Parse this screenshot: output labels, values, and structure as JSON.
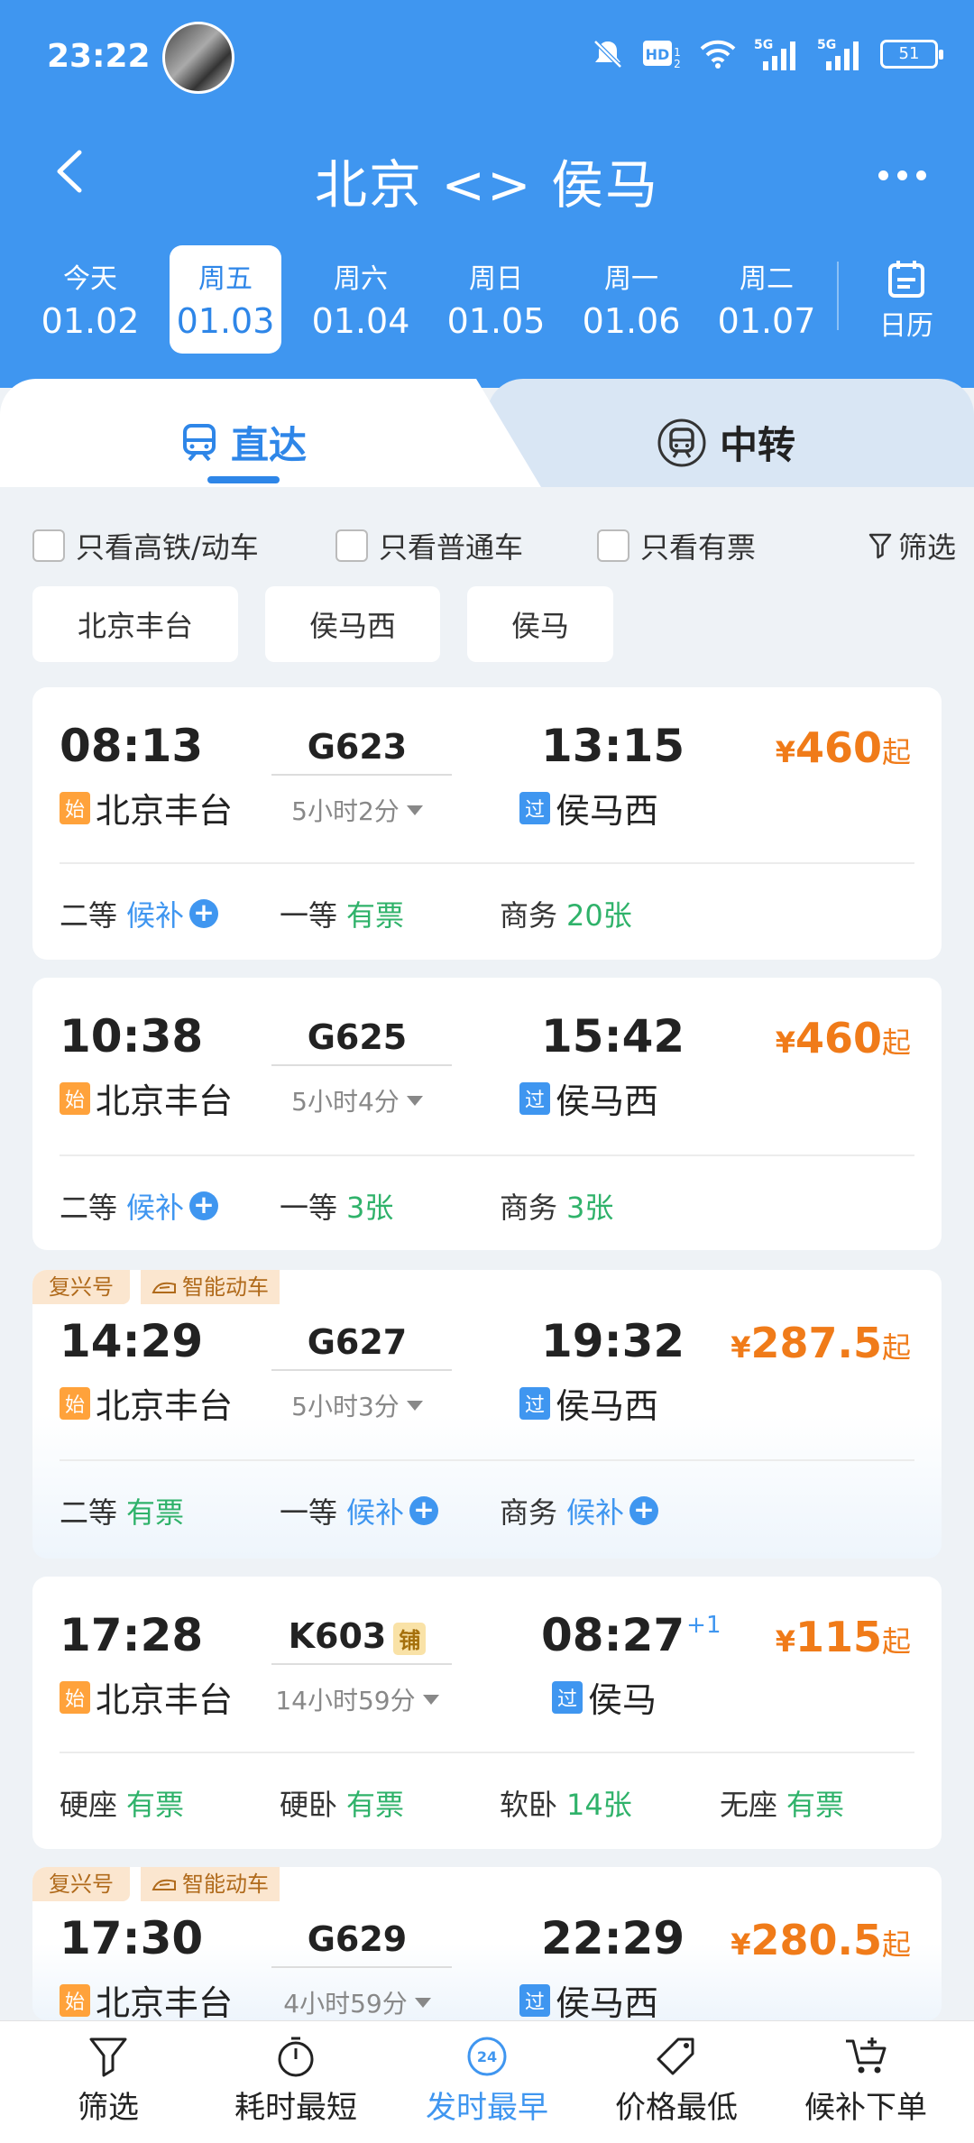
{
  "status": {
    "time": "23:22",
    "battery": "51"
  },
  "nav": {
    "title": "北京 <> 侯马"
  },
  "dates": [
    {
      "weekday": "今天",
      "date": "01.02",
      "active": false
    },
    {
      "weekday": "周五",
      "date": "01.03",
      "active": true
    },
    {
      "weekday": "周六",
      "date": "01.04",
      "active": false
    },
    {
      "weekday": "周日",
      "date": "01.05",
      "active": false
    },
    {
      "weekday": "周一",
      "date": "01.06",
      "active": false
    },
    {
      "weekday": "周二",
      "date": "01.07",
      "active": false
    }
  ],
  "calendar_label": "日历",
  "tabs": {
    "direct": "直达",
    "transfer": "中转"
  },
  "filters": {
    "high_speed": "只看高铁/动车",
    "normal": "只看普通车",
    "available": "只看有票",
    "filter": "筛选"
  },
  "stations": [
    "北京丰台",
    "侯马西",
    "侯马"
  ],
  "trains": [
    {
      "dep_time": "08:13",
      "train_no": "G623",
      "arr_time": "13:15",
      "arr_plus": "",
      "dep_tag": "始",
      "dep_station": "北京丰台",
      "duration": "5小时2分",
      "arr_tag": "过",
      "arr_station": "侯马西",
      "price_yen": "¥",
      "price": "460",
      "price_suffix": "起",
      "badges": [],
      "berth": "",
      "seats": [
        {
          "name": "二等",
          "status": "候补",
          "type": "wait"
        },
        {
          "name": "一等",
          "status": "有票",
          "type": "avail"
        },
        {
          "name": "商务",
          "status": "20张",
          "type": "avail"
        }
      ]
    },
    {
      "dep_time": "10:38",
      "train_no": "G625",
      "arr_time": "15:42",
      "arr_plus": "",
      "dep_tag": "始",
      "dep_station": "北京丰台",
      "duration": "5小时4分",
      "arr_tag": "过",
      "arr_station": "侯马西",
      "price_yen": "¥",
      "price": "460",
      "price_suffix": "起",
      "badges": [],
      "berth": "",
      "seats": [
        {
          "name": "二等",
          "status": "候补",
          "type": "wait"
        },
        {
          "name": "一等",
          "status": "3张",
          "type": "avail"
        },
        {
          "name": "商务",
          "status": "3张",
          "type": "avail"
        }
      ]
    },
    {
      "dep_time": "14:29",
      "train_no": "G627",
      "arr_time": "19:32",
      "arr_plus": "",
      "dep_tag": "始",
      "dep_station": "北京丰台",
      "duration": "5小时3分",
      "arr_tag": "过",
      "arr_station": "侯马西",
      "price_yen": "¥",
      "price": "287.5",
      "price_suffix": "起",
      "badges": [
        "复兴号",
        "智能动车"
      ],
      "berth": "",
      "seats": [
        {
          "name": "二等",
          "status": "有票",
          "type": "avail"
        },
        {
          "name": "一等",
          "status": "候补",
          "type": "wait"
        },
        {
          "name": "商务",
          "status": "候补",
          "type": "wait"
        }
      ]
    },
    {
      "dep_time": "17:28",
      "train_no": "K603",
      "arr_time": "08:27",
      "arr_plus": "+1",
      "dep_tag": "始",
      "dep_station": "北京丰台",
      "duration": "14小时59分",
      "arr_tag": "过",
      "arr_station": "侯马",
      "price_yen": "¥",
      "price": "115",
      "price_suffix": "起",
      "badges": [],
      "berth": "铺",
      "seats": [
        {
          "name": "硬座",
          "status": "有票",
          "type": "avail"
        },
        {
          "name": "硬卧",
          "status": "有票",
          "type": "avail"
        },
        {
          "name": "软卧",
          "status": "14张",
          "type": "avail"
        },
        {
          "name": "无座",
          "status": "有票",
          "type": "avail"
        }
      ]
    },
    {
      "dep_time": "17:30",
      "train_no": "G629",
      "arr_time": "22:29",
      "arr_plus": "",
      "dep_tag": "始",
      "dep_station": "北京丰台",
      "duration": "4小时59分",
      "arr_tag": "过",
      "arr_station": "侯马西",
      "price_yen": "¥",
      "price": "280.5",
      "price_suffix": "起",
      "badges": [
        "复兴号",
        "智能动车"
      ],
      "berth": "",
      "seats": []
    }
  ],
  "bottom": [
    "筛选",
    "耗时最短",
    "发时最早",
    "价格最低",
    "候补下单"
  ],
  "bottom_active_badge": "24",
  "colors": {
    "primary": "#3f96f0",
    "price": "#f07b19",
    "available": "#2fb26a"
  }
}
